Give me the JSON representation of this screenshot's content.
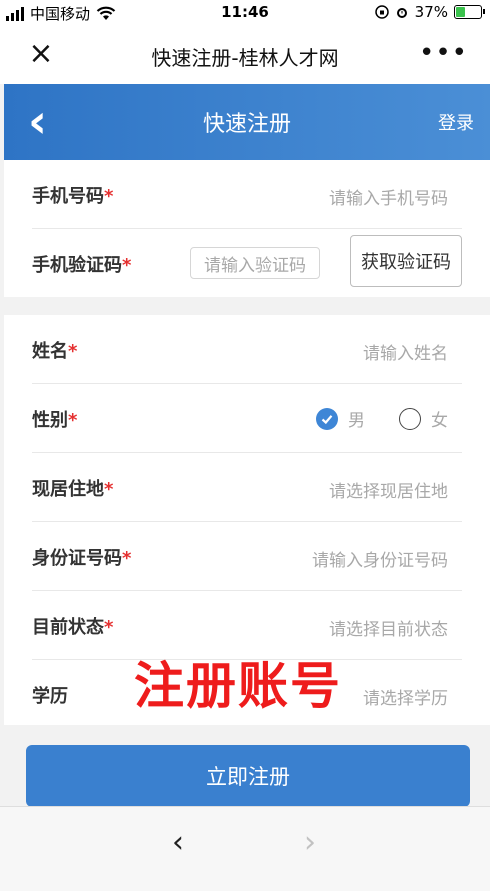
{
  "status_bar": {
    "carrier": "中国移动",
    "time": "11:46",
    "battery": "37%",
    "icons": [
      "signal-icon",
      "wifi-icon",
      "orientation-lock-icon",
      "alarm-icon",
      "battery-icon"
    ]
  },
  "wechat_bar": {
    "close_icon": "×",
    "title": "快速注册-桂林人才网",
    "more_icon": "•••"
  },
  "header": {
    "back_icon": "‹",
    "title": "快速注册",
    "login": "登录",
    "accent_color": "#3a80cf"
  },
  "form": {
    "phone": {
      "label": "手机号码",
      "required": "*",
      "placeholder": "请输入手机号码"
    },
    "sms_code": {
      "label": "手机验证码",
      "required": "*",
      "placeholder": "请输入验证码",
      "button": "获取验证码"
    },
    "name": {
      "label": "姓名",
      "required": "*",
      "placeholder": "请输入姓名"
    },
    "gender": {
      "label": "性别",
      "required": "*",
      "options": [
        "男",
        "女"
      ],
      "selected": "男"
    },
    "residence": {
      "label": "现居住地",
      "required": "*",
      "placeholder": "请选择现居住地"
    },
    "id_number": {
      "label": "身份证号码",
      "required": "*",
      "placeholder": "请输入身份证号码"
    },
    "status": {
      "label": "目前状态",
      "required": "*",
      "placeholder": "请选择目前状态"
    },
    "education": {
      "label": "学历",
      "placeholder": "请选择学历"
    }
  },
  "annotation": "注册账号",
  "submit_label": "立即注册",
  "nav": {
    "back_icon": "‹",
    "forward_icon": "›"
  }
}
